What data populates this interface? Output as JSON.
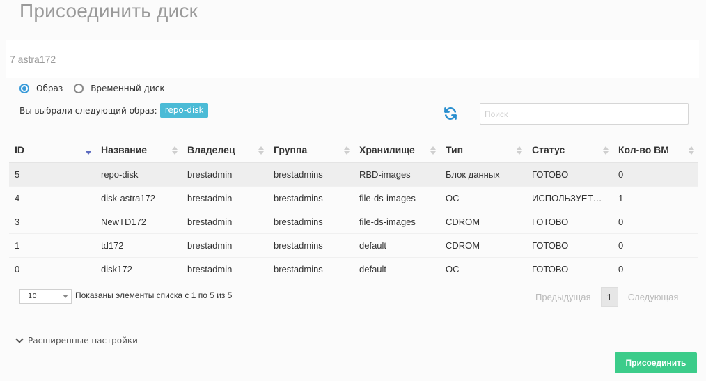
{
  "title": "Присоединить диск",
  "vm_name": "7 astra172",
  "radio": {
    "image_label": "Образ",
    "volatile_label": "Временный диск",
    "selected": "image"
  },
  "selected": {
    "label": "Вы выбрали следующий образ:",
    "value": "repo-disk"
  },
  "search": {
    "placeholder": "Поиск",
    "value": ""
  },
  "table": {
    "columns": [
      "ID",
      "Название",
      "Владелец",
      "Группа",
      "Хранилище",
      "Тип",
      "Статус",
      "Кол-во ВМ"
    ],
    "sort_column": "ID",
    "rows": [
      [
        "5",
        "repo-disk",
        "brestadmin",
        "brestadmins",
        "RBD-images",
        "Блок данных",
        "ГОТОВО",
        "0"
      ],
      [
        "4",
        "disk-astra172",
        "brestadmin",
        "brestadmins",
        "file-ds-images",
        "ОС",
        "ИСПОЛЬЗУЕТ…",
        "1"
      ],
      [
        "3",
        "NewTD172",
        "brestadmin",
        "brestadmins",
        "file-ds-images",
        "CDROM",
        "ГОТОВО",
        "0"
      ],
      [
        "1",
        "td172",
        "brestadmin",
        "brestadmins",
        "default",
        "CDROM",
        "ГОТОВО",
        "0"
      ],
      [
        "0",
        "disk172",
        "brestadmin",
        "brestadmins",
        "default",
        "ОС",
        "ГОТОВО",
        "0"
      ]
    ],
    "selected_row": 0
  },
  "footer": {
    "page_size": "10",
    "info": "Показаны элементы списка с 1 по 5 из 5",
    "prev": "Предыдущая",
    "page": "1",
    "next": "Следующая"
  },
  "advanced_label": "Расширенные настройки",
  "attach_label": "Присоединить",
  "colors": {
    "accent": "#3a9bd9",
    "badge": "#4bbbd6",
    "attach": "#3ccc8a",
    "refresh": "#2a8fcf"
  },
  "icons": [
    "radio-icon",
    "refresh-icon",
    "sort-icon",
    "chevron-down-icon",
    "caret-down-icon"
  ]
}
